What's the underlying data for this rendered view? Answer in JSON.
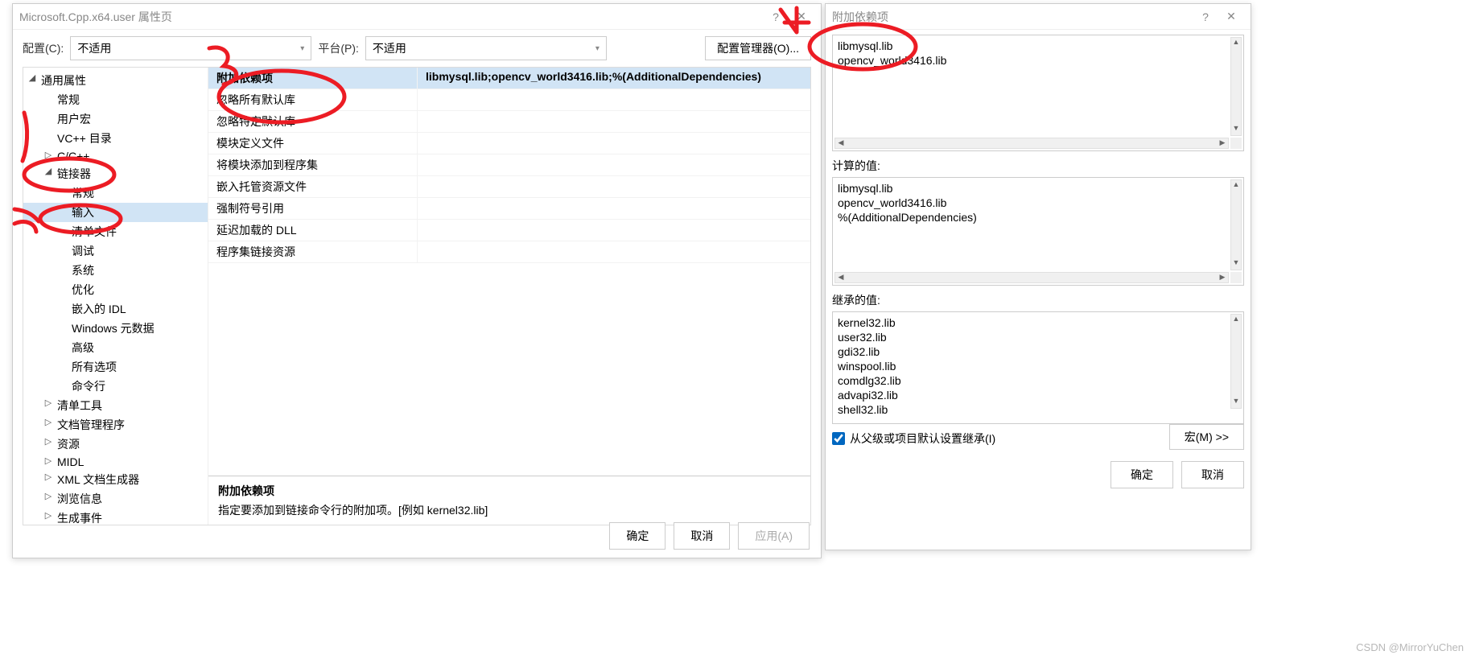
{
  "main": {
    "title": "Microsoft.Cpp.x64.user 属性页",
    "config_label": "配置(C):",
    "config_value": "不适用",
    "platform_label": "平台(P):",
    "platform_value": "不适用",
    "config_mgr": "配置管理器(O)...",
    "tree": [
      {
        "label": "通用属性",
        "depth": 0,
        "expanded": true
      },
      {
        "label": "常规",
        "depth": 1
      },
      {
        "label": "用户宏",
        "depth": 1
      },
      {
        "label": "VC++ 目录",
        "depth": 1
      },
      {
        "label": "C/C++",
        "depth": 1,
        "expandable": true
      },
      {
        "label": "链接器",
        "depth": 1,
        "expanded": true
      },
      {
        "label": "常规",
        "depth": 2
      },
      {
        "label": "输入",
        "depth": 2,
        "selected": true
      },
      {
        "label": "清单文件",
        "depth": 2
      },
      {
        "label": "调试",
        "depth": 2
      },
      {
        "label": "系统",
        "depth": 2
      },
      {
        "label": "优化",
        "depth": 2
      },
      {
        "label": "嵌入的 IDL",
        "depth": 2
      },
      {
        "label": "Windows 元数据",
        "depth": 2
      },
      {
        "label": "高级",
        "depth": 2
      },
      {
        "label": "所有选项",
        "depth": 2
      },
      {
        "label": "命令行",
        "depth": 2
      },
      {
        "label": "清单工具",
        "depth": 1,
        "expandable": true
      },
      {
        "label": "文档管理程序",
        "depth": 1,
        "expandable": true
      },
      {
        "label": "资源",
        "depth": 1,
        "expandable": true
      },
      {
        "label": "MIDL",
        "depth": 1,
        "expandable": true
      },
      {
        "label": "XML 文档生成器",
        "depth": 1,
        "expandable": true
      },
      {
        "label": "浏览信息",
        "depth": 1,
        "expandable": true
      },
      {
        "label": "生成事件",
        "depth": 1,
        "expandable": true
      }
    ],
    "props": [
      {
        "key": "附加依赖项",
        "val": "libmysql.lib;opencv_world3416.lib;%(AdditionalDependencies)",
        "selected": true
      },
      {
        "key": "忽略所有默认库",
        "val": ""
      },
      {
        "key": "忽略特定默认库",
        "val": ""
      },
      {
        "key": "模块定义文件",
        "val": ""
      },
      {
        "key": "将模块添加到程序集",
        "val": ""
      },
      {
        "key": "嵌入托管资源文件",
        "val": ""
      },
      {
        "key": "强制符号引用",
        "val": ""
      },
      {
        "key": "延迟加载的 DLL",
        "val": ""
      },
      {
        "key": "程序集链接资源",
        "val": ""
      }
    ],
    "desc_title": "附加依赖项",
    "desc_text": "指定要添加到链接命令行的附加项。[例如 kernel32.lib]",
    "ok": "确定",
    "cancel": "取消",
    "apply": "应用(A)"
  },
  "deps": {
    "title": "附加依赖项",
    "entered": [
      "libmysql.lib",
      "opencv_world3416.lib"
    ],
    "computed_label": "计算的值:",
    "computed": [
      "libmysql.lib",
      "opencv_world3416.lib",
      "%(AdditionalDependencies)"
    ],
    "inherited_label": "继承的值:",
    "inherited": [
      "kernel32.lib",
      "user32.lib",
      "gdi32.lib",
      "winspool.lib",
      "comdlg32.lib",
      "advapi32.lib",
      "shell32.lib"
    ],
    "inherit_check": "从父级或项目默认设置继承(I)",
    "macro_btn": "宏(M) >>",
    "ok": "确定",
    "cancel": "取消"
  },
  "watermark": "CSDN @MirrorYuChen"
}
